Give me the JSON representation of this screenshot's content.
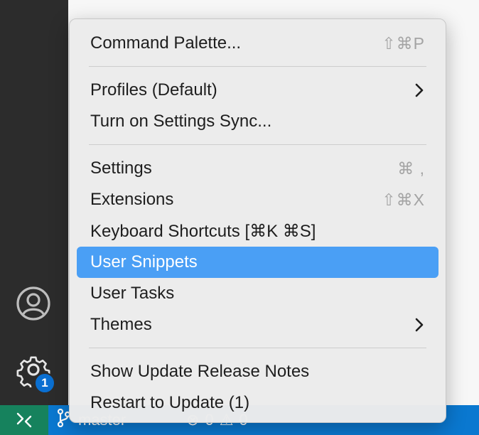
{
  "menu": {
    "groups": [
      [
        {
          "label": "Command Palette...",
          "shortcut": "⇧⌘P"
        }
      ],
      [
        {
          "label": "Profiles (Default)",
          "submenu": true
        },
        {
          "label": "Turn on Settings Sync..."
        }
      ],
      [
        {
          "label": "Settings",
          "shortcut": "⌘ ,"
        },
        {
          "label": "Extensions",
          "shortcut": "⇧⌘X"
        },
        {
          "label": "Keyboard Shortcuts [⌘K ⌘S]"
        },
        {
          "label": "User Snippets",
          "selected": true
        },
        {
          "label": "User Tasks"
        },
        {
          "label": "Themes",
          "submenu": true
        }
      ],
      [
        {
          "label": "Show Update Release Notes"
        },
        {
          "label": "Restart to Update (1)"
        }
      ]
    ]
  },
  "activity_bar": {
    "account_icon": "account-icon",
    "manage_icon": "gear-icon",
    "manage_badge": "1"
  },
  "status_bar": {
    "remote_icon": "remote-icon",
    "branch": "master",
    "errors": "0",
    "warnings": "0"
  },
  "colors": {
    "selection": "#4a9ff5",
    "status_bar": "#0a78d0",
    "remote": "#16825d",
    "badge": "#0a6fd1"
  }
}
